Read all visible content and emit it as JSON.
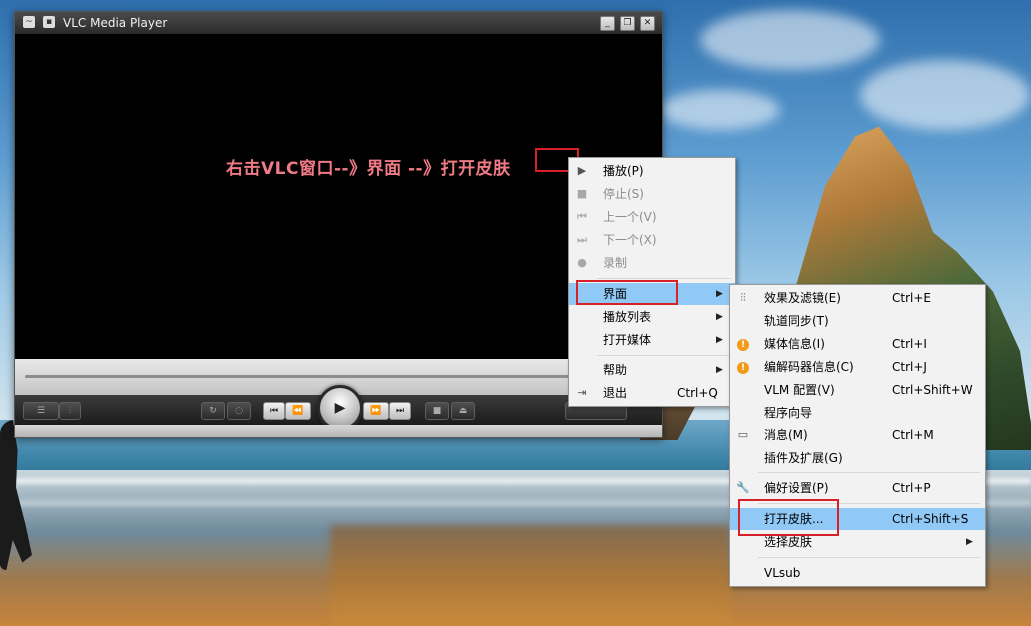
{
  "window": {
    "title": "VLC Media Player",
    "annotation": "右击VLC窗口--》界面 --》打开皮肤",
    "controls": {
      "play": "▶",
      "prev": "⏮",
      "rewind": "⏪",
      "forward": "⏩",
      "next": "⏭",
      "stop": "■",
      "eject": "⏏"
    }
  },
  "main_menu": {
    "items": [
      {
        "icon": "play-icon",
        "label": "播放(P)",
        "enabled": true
      },
      {
        "icon": "stop-icon",
        "label": "停止(S)",
        "enabled": false
      },
      {
        "icon": "previous-icon",
        "label": "上一个(V)",
        "enabled": false
      },
      {
        "icon": "next-icon",
        "label": "下一个(X)",
        "enabled": false
      },
      {
        "icon": "record-icon",
        "label": "录制",
        "enabled": false
      },
      {
        "label": "界面",
        "submenu": true,
        "highlighted": true
      },
      {
        "label": "播放列表",
        "submenu": true
      },
      {
        "label": "打开媒体",
        "submenu": true
      },
      {
        "label": "帮助",
        "submenu": true
      },
      {
        "icon": "exit-icon",
        "label": "退出",
        "shortcut": "Ctrl+Q"
      }
    ]
  },
  "interface_submenu": {
    "items": [
      {
        "icon": "equalizer-icon",
        "label": "效果及滤镜(E)",
        "shortcut": "Ctrl+E"
      },
      {
        "label": "轨道同步(T)",
        "shortcut": ""
      },
      {
        "icon": "info-orange-icon",
        "label": "媒体信息(I)",
        "shortcut": "Ctrl+I"
      },
      {
        "icon": "info-orange-icon",
        "label": "编解码器信息(C)",
        "shortcut": "Ctrl+J"
      },
      {
        "label": "VLM 配置(V)",
        "shortcut": "Ctrl+Shift+W"
      },
      {
        "label": "程序向导",
        "shortcut": ""
      },
      {
        "icon": "terminal-icon",
        "label": "消息(M)",
        "shortcut": "Ctrl+M"
      },
      {
        "label": "插件及扩展(G)",
        "shortcut": ""
      },
      {
        "icon": "wrench-icon",
        "label": "偏好设置(P)",
        "shortcut": "Ctrl+P"
      },
      {
        "label": "打开皮肤...",
        "shortcut": "Ctrl+Shift+S",
        "highlighted": true
      },
      {
        "label": "选择皮肤",
        "submenu": true
      },
      {
        "label": "VLsub",
        "shortcut": ""
      }
    ]
  },
  "colors": {
    "annotation": "#f07a85",
    "menu_highlight": "#90c8f6",
    "red_box": "#d6202a"
  }
}
